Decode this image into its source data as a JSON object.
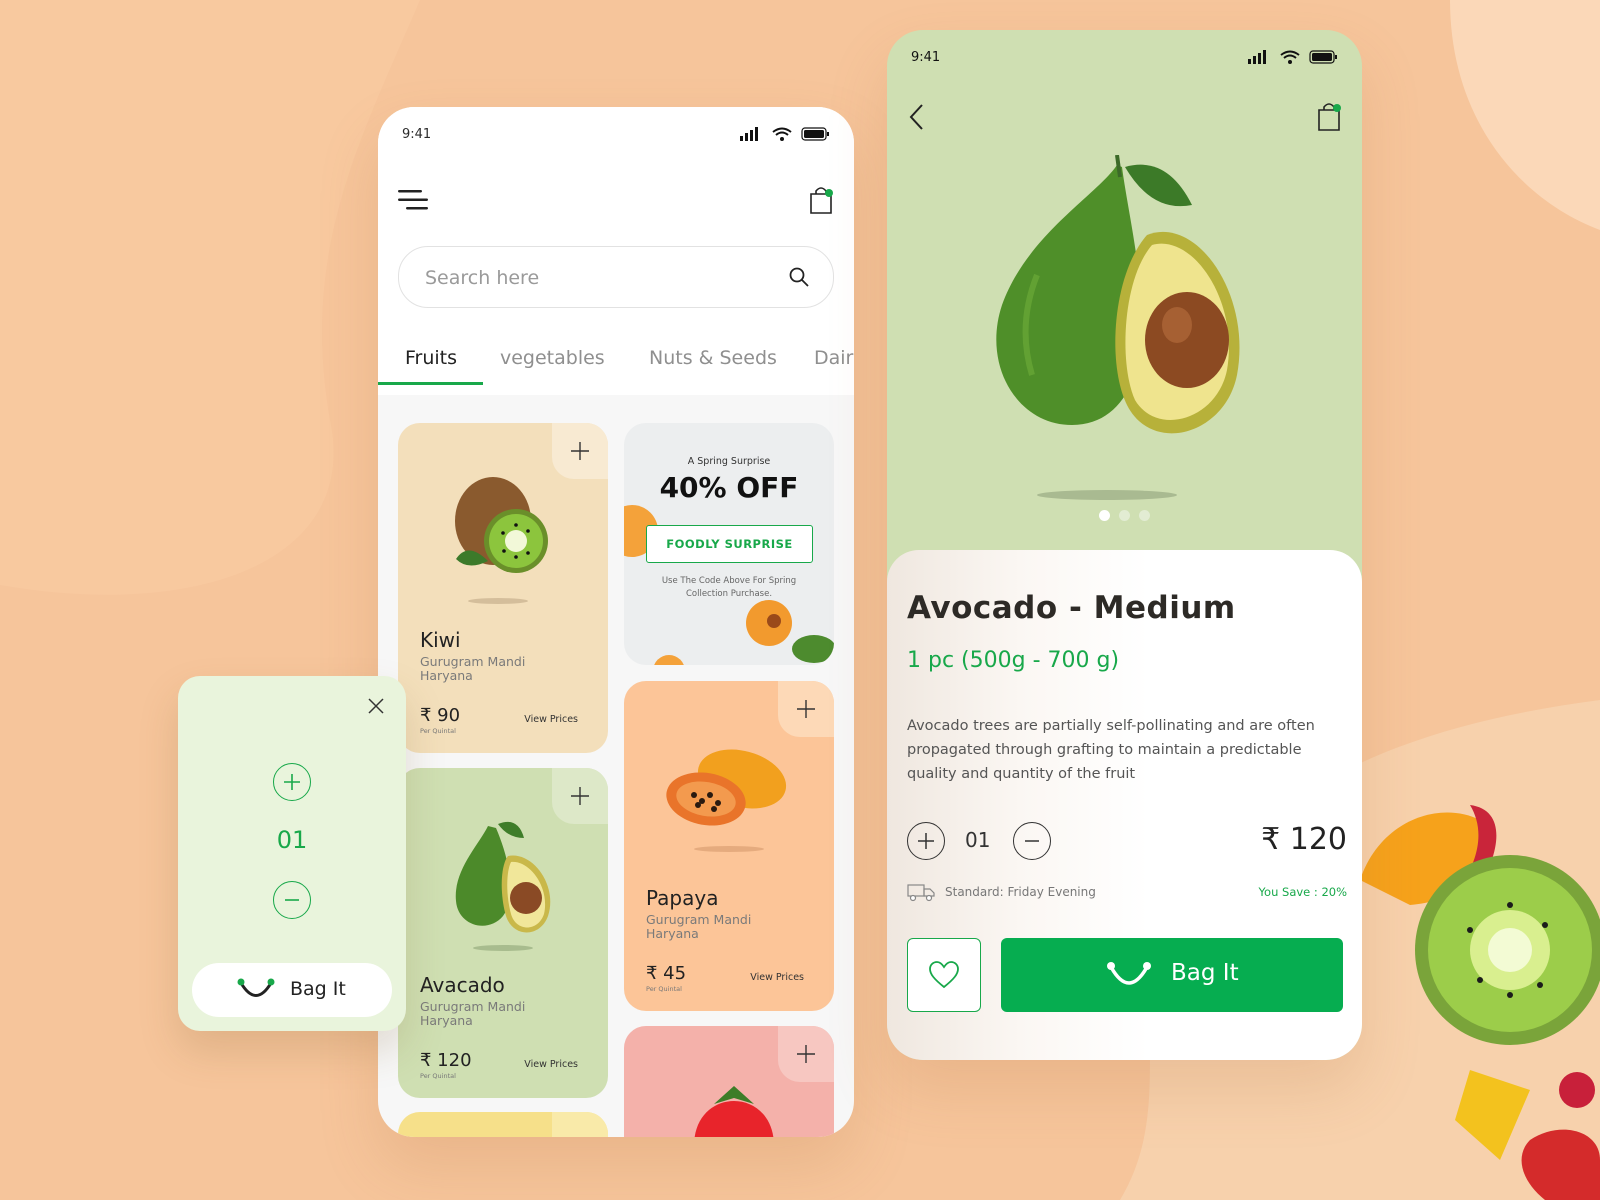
{
  "colors": {
    "background": "#f6c59b",
    "accent_green": "#18a84a",
    "kiwi_card": "#f3dfbb",
    "avocado_card": "#cfdfb2",
    "papaya_card": "#fcc598",
    "strawberry_card": "#f4b1aa",
    "popup_bg": "#e9f4dc"
  },
  "list_screen": {
    "status_time": "9:41",
    "search": {
      "placeholder": "Search here"
    },
    "tabs": [
      {
        "label": "Fruits",
        "active": true
      },
      {
        "label": "vegetables",
        "active": false
      },
      {
        "label": "Nuts & Seeds",
        "active": false
      },
      {
        "label": "Dairy",
        "active": false
      }
    ],
    "products": [
      {
        "name": "Kiwi",
        "location": "Gurugram Mandi Haryana",
        "price": "₹ 90",
        "unit": "Per Quintal",
        "link": "View Prices",
        "icon": "kiwi"
      },
      {
        "name": "Avacado",
        "location": "Gurugram Mandi Haryana",
        "price": "₹ 120",
        "unit": "Per Quintal",
        "link": "View Prices",
        "icon": "avocado"
      },
      {
        "name": "Papaya",
        "location": "Gurugram Mandi Haryana",
        "price": "₹ 45",
        "unit": "Per Quintal",
        "link": "View Prices",
        "icon": "papaya"
      },
      {
        "name": "",
        "icon": "strawberry"
      }
    ],
    "promo": {
      "kicker": "A Spring Surprise",
      "headline": "40% OFF",
      "code": "FOODLY SURPRISE",
      "note": "Use The Code Above For Spring Collection Purchase."
    }
  },
  "quantity_popup": {
    "quantity": "01",
    "button_label": "Bag It"
  },
  "detail_screen": {
    "status_time": "9:41",
    "title": "Avocado - Medium",
    "weight": "1 pc (500g - 700 g)",
    "description": "Avocado trees are partially self-pollinating and are often propagated through grafting to maintain a predictable quality and quantity of the fruit",
    "quantity": "01",
    "price": "₹ 120",
    "shipping": "Standard: Friday Evening",
    "savings": "You Save : 20%",
    "button_label": "Bag It",
    "carousel_active_index": 0,
    "carousel_count": 3
  }
}
